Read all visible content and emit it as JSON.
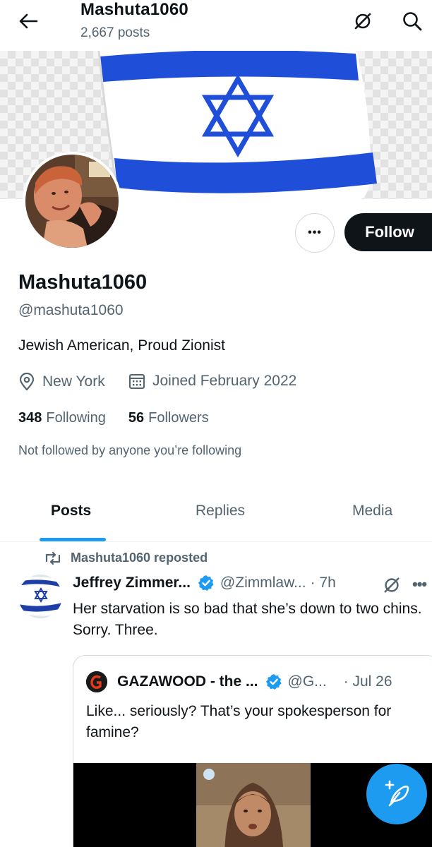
{
  "header": {
    "title": "Mashuta1060",
    "posts_count": "2,667 posts",
    "back_icon": "arrow-left-icon",
    "grok_icon": "grok-icon",
    "search_icon": "search-icon"
  },
  "banner": {
    "image": "israeli-flag"
  },
  "profile": {
    "display_name": "Mashuta1060",
    "handle": "@mashuta1060",
    "bio": "Jewish American, Proud Zionist",
    "location": "New York",
    "joined": "Joined February 2022",
    "following_count": "348",
    "following_label": "Following",
    "followers_count": "56",
    "followers_label": "Followers",
    "followed_by_note": "Not followed by anyone you’re following",
    "follow_label": "Follow",
    "more_label": "•••"
  },
  "tabs": [
    {
      "label": "Posts",
      "active": true
    },
    {
      "label": "Replies",
      "active": false
    },
    {
      "label": "Media",
      "active": false
    }
  ],
  "post": {
    "repost_label": "Mashuta1060 reposted",
    "author": "Jeffrey Zimmer...",
    "handle": "@Zimmlaw...",
    "time": "· 7h",
    "more": "•••",
    "text": "Her starvation is so bad that she’s down to two chins.  Sorry. Three.",
    "quote": {
      "author": "GAZAWOOD - the ...",
      "handle": "@G...",
      "date": "· Jul 26",
      "text": "Like... seriously? That’s your spokesperson for famine?"
    }
  },
  "colors": {
    "accent": "#1d9bf0",
    "text": "#0f1419",
    "secondary": "#536471",
    "follow_bg": "#0f1419"
  }
}
